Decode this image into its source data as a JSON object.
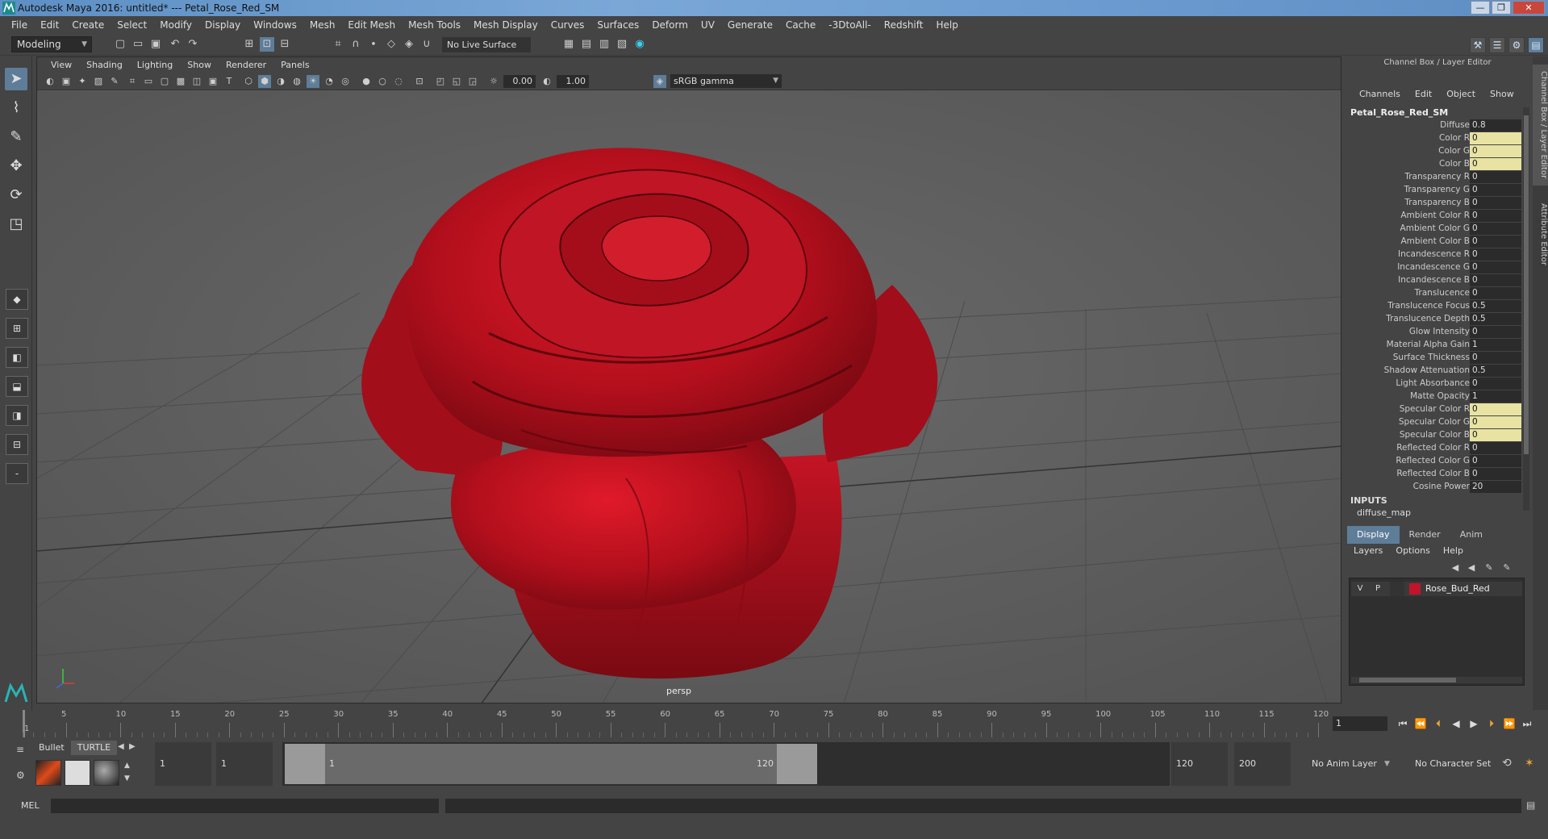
{
  "window": {
    "title": "Autodesk Maya 2016: untitled*   ---   Petal_Rose_Red_SM",
    "controls": [
      "—",
      "❐",
      "✕"
    ]
  },
  "menubar": [
    "File",
    "Edit",
    "Create",
    "Select",
    "Modify",
    "Display",
    "Windows",
    "Mesh",
    "Edit Mesh",
    "Mesh Tools",
    "Mesh Display",
    "Curves",
    "Surfaces",
    "Deform",
    "UV",
    "Generate",
    "Cache",
    "-3DtoAll-",
    "Redshift",
    "Help"
  ],
  "statusline": {
    "mode": "Modeling",
    "live_surface": "No Live Surface"
  },
  "viewport": {
    "menus": [
      "View",
      "Shading",
      "Lighting",
      "Show",
      "Renderer",
      "Panels"
    ],
    "exposure": "0.00",
    "gamma": "1.00",
    "color_space": "sRGB gamma",
    "camera": "persp"
  },
  "channel_box": {
    "title": "Channel Box / Layer Editor",
    "menus": [
      "Channels",
      "Edit",
      "Object",
      "Show"
    ],
    "object": "Petal_Rose_Red_SM",
    "attributes": [
      {
        "label": "Diffuse",
        "value": "0.8",
        "keyed": false
      },
      {
        "label": "Color R",
        "value": "0",
        "keyed": true
      },
      {
        "label": "Color G",
        "value": "0",
        "keyed": true
      },
      {
        "label": "Color B",
        "value": "0",
        "keyed": true
      },
      {
        "label": "Transparency R",
        "value": "0",
        "keyed": false
      },
      {
        "label": "Transparency G",
        "value": "0",
        "keyed": false
      },
      {
        "label": "Transparency B",
        "value": "0",
        "keyed": false
      },
      {
        "label": "Ambient Color R",
        "value": "0",
        "keyed": false
      },
      {
        "label": "Ambient Color G",
        "value": "0",
        "keyed": false
      },
      {
        "label": "Ambient Color B",
        "value": "0",
        "keyed": false
      },
      {
        "label": "Incandescence R",
        "value": "0",
        "keyed": false
      },
      {
        "label": "Incandescence G",
        "value": "0",
        "keyed": false
      },
      {
        "label": "Incandescence B",
        "value": "0",
        "keyed": false
      },
      {
        "label": "Translucence",
        "value": "0",
        "keyed": false
      },
      {
        "label": "Translucence Focus",
        "value": "0.5",
        "keyed": false
      },
      {
        "label": "Translucence Depth",
        "value": "0.5",
        "keyed": false
      },
      {
        "label": "Glow Intensity",
        "value": "0",
        "keyed": false
      },
      {
        "label": "Material Alpha Gain",
        "value": "1",
        "keyed": false
      },
      {
        "label": "Surface Thickness",
        "value": "0",
        "keyed": false
      },
      {
        "label": "Shadow Attenuation",
        "value": "0.5",
        "keyed": false
      },
      {
        "label": "Light Absorbance",
        "value": "0",
        "keyed": false
      },
      {
        "label": "Matte Opacity",
        "value": "1",
        "keyed": false
      },
      {
        "label": "Specular Color R",
        "value": "0",
        "keyed": true
      },
      {
        "label": "Specular Color G",
        "value": "0",
        "keyed": true
      },
      {
        "label": "Specular Color B",
        "value": "0",
        "keyed": true
      },
      {
        "label": "Reflected Color R",
        "value": "0",
        "keyed": false
      },
      {
        "label": "Reflected Color G",
        "value": "0",
        "keyed": false
      },
      {
        "label": "Reflected Color B",
        "value": "0",
        "keyed": false
      },
      {
        "label": "Cosine Power",
        "value": "20",
        "keyed": false
      }
    ],
    "inputs_label": "INPUTS",
    "inputs_item": "diffuse_map"
  },
  "side_tabs": [
    "Channel Box / Layer Editor",
    "Attribute Editor"
  ],
  "layer_editor": {
    "tabs": [
      "Display",
      "Render",
      "Anim"
    ],
    "menus": [
      "Layers",
      "Options",
      "Help"
    ],
    "layer": {
      "v": "V",
      "p": "P",
      "name": "Rose_Bud_Red",
      "color": "#c0142a"
    }
  },
  "timeline": {
    "ticks": [
      "5",
      "10",
      "15",
      "20",
      "25",
      "30",
      "35",
      "40",
      "45",
      "50",
      "55",
      "60",
      "65",
      "70",
      "75",
      "80",
      "85",
      "90",
      "95",
      "100",
      "105",
      "110",
      "115",
      "120"
    ],
    "current_frame_label": "1",
    "current_frame": "1"
  },
  "range": {
    "shelf_tabs": [
      "Bullet",
      "TURTLE"
    ],
    "start": "1",
    "playback_start": "1",
    "slider_start": "1",
    "slider_end": "120",
    "playback_end": "120",
    "end": "200",
    "anim_layer": "No Anim Layer",
    "character_set": "No Character Set"
  },
  "cmdline": {
    "label": "MEL"
  },
  "colors": {
    "accent": "#5e7d98",
    "keyed": "#e8e3a3",
    "rose": "#c0142a"
  }
}
